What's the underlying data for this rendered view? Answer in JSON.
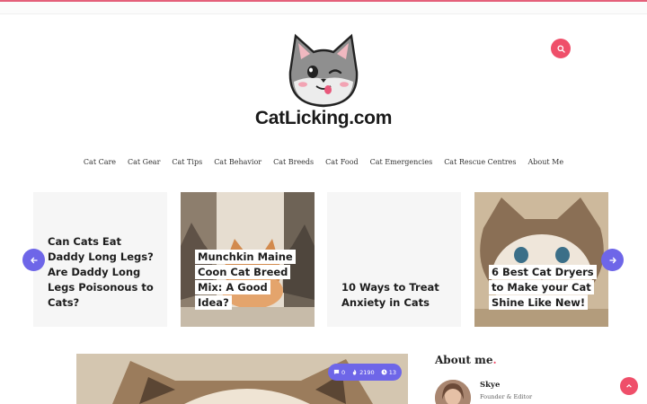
{
  "site": {
    "logo_text": "CatLicking.com",
    "accent_color": "#ef4f6a",
    "secondary_color": "#6e66e8"
  },
  "header": {
    "search_icon": "search-icon"
  },
  "nav": {
    "items": [
      "Cat Care",
      "Cat Gear",
      "Cat Tips",
      "Cat Behavior",
      "Cat Breeds",
      "Cat Food",
      "Cat Emergencies",
      "Cat Rescue Centres",
      "About Me"
    ]
  },
  "slider": {
    "prev_icon": "arrow-left-icon",
    "next_icon": "arrow-right-icon",
    "cards": [
      {
        "title": "Can Cats Eat Daddy Long Legs? Are Daddy Long Legs Poisonous to Cats?"
      },
      {
        "title": "Munchkin Maine Coon Cat Breed Mix: A Good Idea?"
      },
      {
        "title": "10 Ways to Treat Anxiety in Cats"
      },
      {
        "title": "6 Best Cat Dryers to Make your Cat Shine Like New!"
      }
    ]
  },
  "featured": {
    "comments": "0",
    "views": "2190",
    "read_time": "13"
  },
  "sidebar": {
    "about_title": "About me",
    "about_dot": ".",
    "author_name": "Skye",
    "author_role": "Founder & Editor"
  },
  "back_to_top_icon": "arrow-up-icon"
}
